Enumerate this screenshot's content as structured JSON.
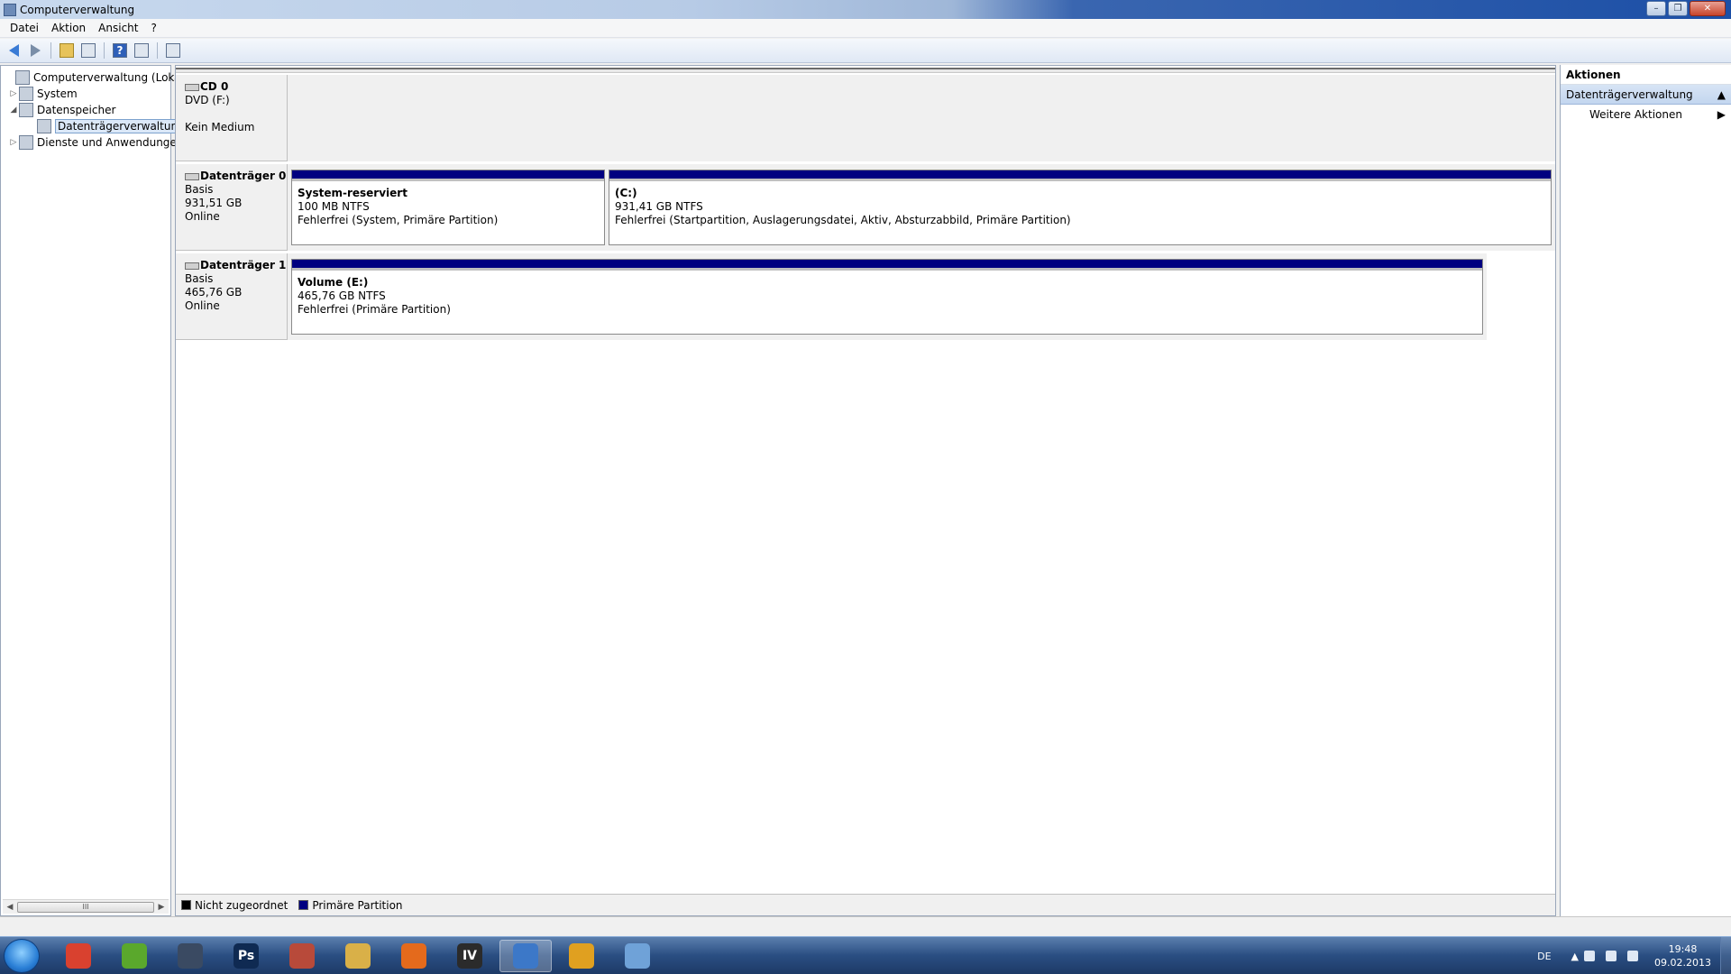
{
  "window": {
    "title": "Computerverwaltung"
  },
  "menu": {
    "items": [
      "Datei",
      "Aktion",
      "Ansicht",
      "?"
    ]
  },
  "toolbar": {
    "help_glyph": "?"
  },
  "tree": {
    "items": [
      {
        "label": "Computerverwaltung (Lokal)",
        "expander": "",
        "icon": "computer-icon"
      },
      {
        "label": "System",
        "expander": "▷",
        "icon": "tools-icon"
      },
      {
        "label": "Datenspeicher",
        "expander": "◢",
        "icon": "storage-icon"
      },
      {
        "label": "Datenträgerverwaltung",
        "expander": "",
        "icon": "disk-management-icon"
      },
      {
        "label": "Dienste und Anwendungen",
        "expander": "▷",
        "icon": "services-icon"
      }
    ],
    "scroll_thumb": "III"
  },
  "disks": [
    {
      "name": "CD 0",
      "line1": "DVD (F:)",
      "line2": "",
      "line3": "Kein Medium"
    },
    {
      "name": "Datenträger 0",
      "line1": "Basis",
      "line2": "931,51 GB",
      "line3": "Online"
    },
    {
      "name": "Datenträger 1",
      "line1": "Basis",
      "line2": "465,76 GB",
      "line3": "Online"
    }
  ],
  "partitions": {
    "system_reserved": {
      "name": "System-reserviert",
      "size": "100 MB NTFS",
      "status": "Fehlerfrei (System, Primäre Partition)"
    },
    "c_drive": {
      "name": "(C:)",
      "size": "931,41 GB NTFS",
      "status": "Fehlerfrei (Startpartition, Auslagerungsdatei, Aktiv, Absturzabbild, Primäre Partition)"
    },
    "e_drive": {
      "name": "Volume  (E:)",
      "size": "465,76 GB NTFS",
      "status": "Fehlerfrei (Primäre Partition)"
    }
  },
  "legend": [
    {
      "label": "Nicht zugeordnet",
      "color": "#000000"
    },
    {
      "label": "Primäre Partition",
      "color": "#000080"
    }
  ],
  "actions": {
    "header": "Aktionen",
    "section": "Datenträgerverwaltung",
    "section_arrow": "▲",
    "item": "Weitere Aktionen",
    "item_arrow": "▶"
  },
  "taskbar": {
    "apps": [
      {
        "name": "chrome-icon",
        "glyph": "",
        "color": "#d9412f"
      },
      {
        "name": "spotify-icon",
        "glyph": "",
        "color": "#5aa82c"
      },
      {
        "name": "steam-icon",
        "glyph": "",
        "color": "#3a4a62"
      },
      {
        "name": "photoshop-icon",
        "glyph": "Ps",
        "color": "#0f2a52"
      },
      {
        "name": "game-icon",
        "glyph": "",
        "color": "#b84a3a"
      },
      {
        "name": "explorer-icon",
        "glyph": "",
        "color": "#d9b048"
      },
      {
        "name": "origin-icon",
        "glyph": "",
        "color": "#e46a1c"
      },
      {
        "name": "gta-iv-icon",
        "glyph": "IV",
        "color": "#2b2b2b"
      },
      {
        "name": "computer-management-icon",
        "glyph": "",
        "color": "#3c78c8"
      },
      {
        "name": "media-icon",
        "glyph": "",
        "color": "#e0a020"
      },
      {
        "name": "paint-icon",
        "glyph": "",
        "color": "#6fa2d8"
      }
    ],
    "language": "DE",
    "time": "19:48",
    "date": "09.02.2013"
  }
}
